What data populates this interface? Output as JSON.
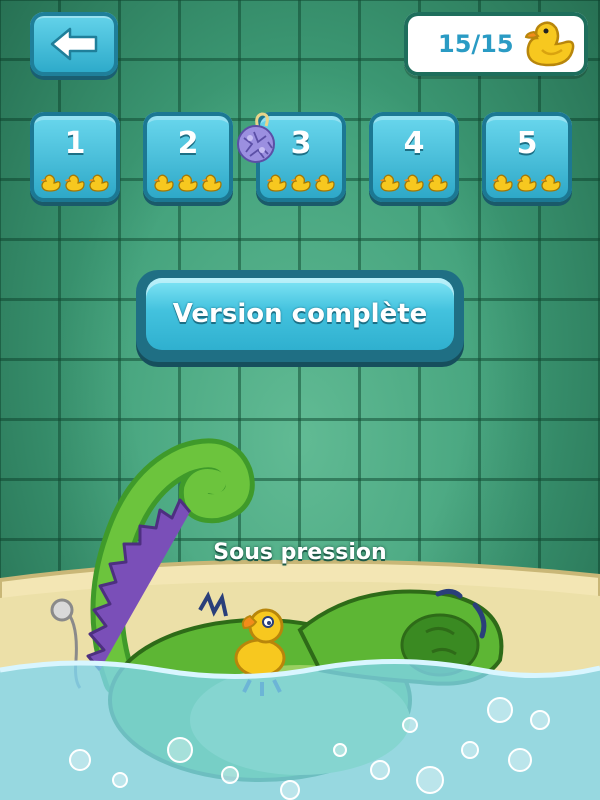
{
  "header": {
    "back_icon": "left-arrow-icon",
    "score": "15/15",
    "score_icon": "rubber-duck-icon"
  },
  "levels": [
    {
      "number": "1",
      "ducks": 3
    },
    {
      "number": "2",
      "ducks": 3
    },
    {
      "number": "3",
      "ducks": 3
    },
    {
      "number": "4",
      "ducks": 3
    },
    {
      "number": "5",
      "ducks": 3
    }
  ],
  "full_version": {
    "label": "Version complète"
  },
  "chapter": {
    "title": "Sous pression"
  },
  "colors": {
    "button": "#2ba6c6",
    "wall": "#3f9e78",
    "duck": "#f7c81f",
    "water": "#7fd6f0"
  }
}
